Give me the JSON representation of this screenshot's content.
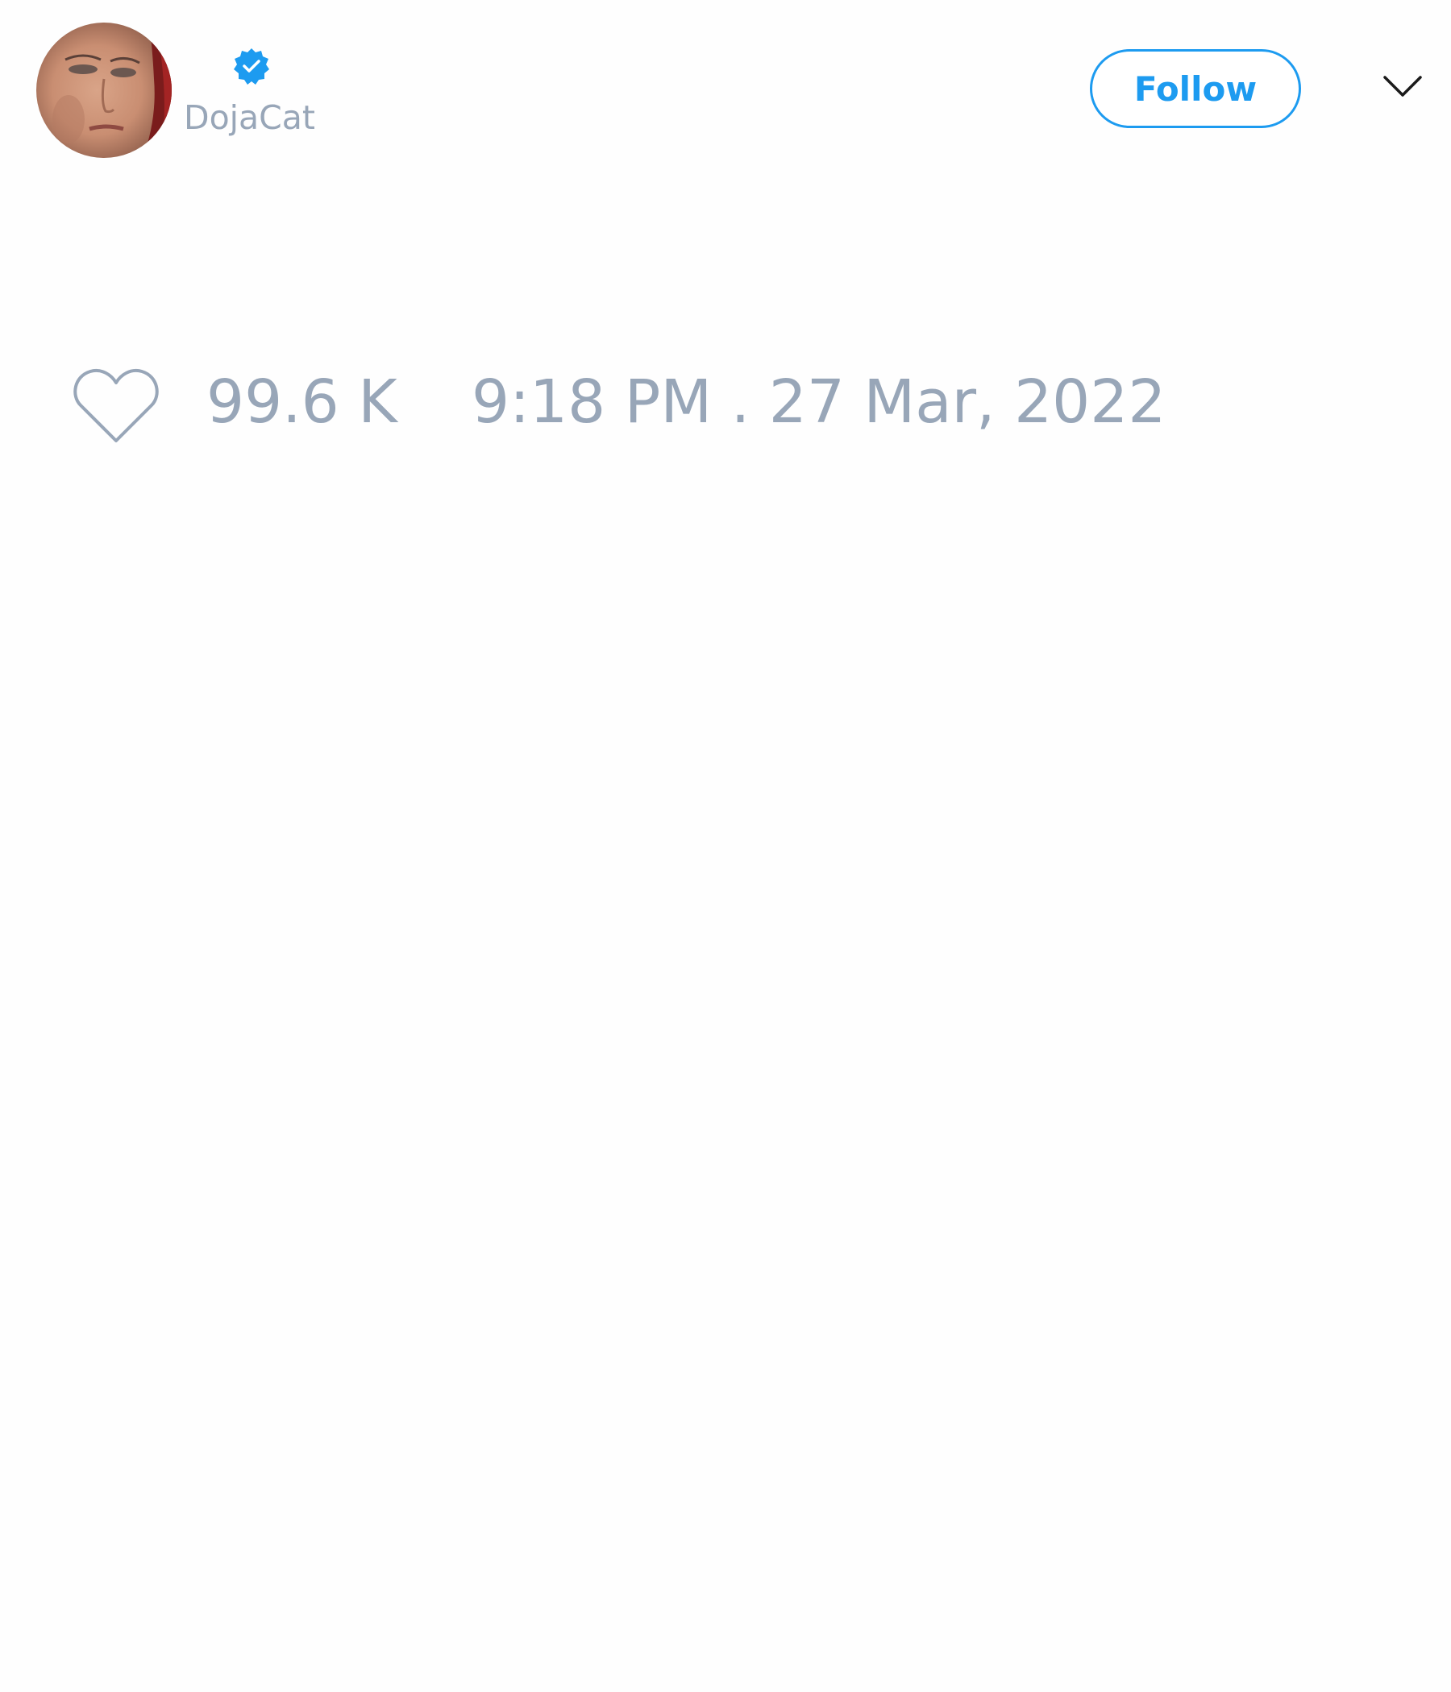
{
  "author": {
    "handle": "DojaCat",
    "verified": true,
    "avatar_icon": "profile-photo"
  },
  "actions": {
    "follow_label": "Follow",
    "menu_icon": "chevron-down-icon"
  },
  "engagement": {
    "like_icon": "heart-outline-icon",
    "like_count": "99.6 K",
    "timestamp": "9:18 PM . 27 Mar, 2022"
  },
  "colors": {
    "accent": "#1d9bf0",
    "muted_text": "#98a6b8",
    "background": "#fefefe"
  }
}
